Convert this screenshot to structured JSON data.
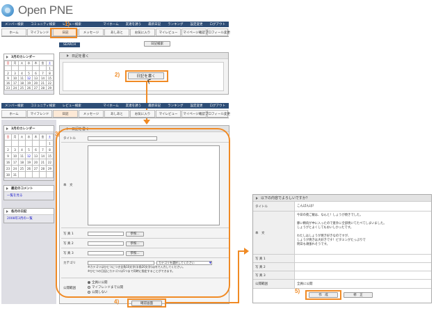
{
  "app": {
    "title": "Open PNE"
  },
  "searchbar": {
    "items": [
      "メンバー検索",
      "コミュニティ検索",
      "レビュー検索",
      "マイホーム",
      "友達を誘う",
      "最新日記",
      "ランキング",
      "設定変更",
      "ログアウト"
    ]
  },
  "nav": {
    "tabs": [
      "ホーム",
      "マイフレンド",
      "日記",
      "メッセージ",
      "あしあと",
      "お気に入り",
      "マイレビュー",
      "マイページ確認",
      "プロフィール変更"
    ]
  },
  "search": {
    "button": "SEARCH",
    "diary_search": "日記検索"
  },
  "calendar": {
    "title": "3月のカレンダー",
    "weekdays": [
      "日",
      "月",
      "火",
      "水",
      "木",
      "金",
      "土"
    ],
    "rows": [
      [
        "",
        "",
        "",
        "",
        "",
        "",
        "1"
      ],
      [
        "2",
        "3",
        "4",
        "5",
        "6",
        "7",
        "8"
      ],
      [
        "9",
        "10",
        "11",
        "12",
        "13",
        "14",
        "15"
      ],
      [
        "16",
        "17",
        "18",
        "19",
        "20",
        "21",
        "22"
      ],
      [
        "23",
        "24",
        "25",
        "26",
        "27",
        "28",
        "29"
      ],
      [
        "30",
        "31",
        "",
        "",
        "",
        "",
        ""
      ]
    ]
  },
  "top_panel": {
    "header": "日記を書く",
    "write_button": "日記を書く"
  },
  "form": {
    "header": "日記を書く",
    "title_label": "タイトル",
    "body_label": "本　文",
    "photo1": "写 真 1",
    "photo2": "写 真 2",
    "photo3": "写 真 3",
    "browse": "参照...",
    "category_label": "カテゴリ",
    "category_select": "カテゴリを選択してください",
    "category_note1": "※カテゴリはひとつにつき全角10文字(半角20文字)以内で入力してください。",
    "category_note2": "※ひとつの日記にカテゴリは5つまで同時に指定することができます。",
    "visibility_label": "公開範囲",
    "vis_options": [
      "全員に公開",
      "マイフレンドまで公開",
      "公開しない"
    ],
    "confirm_button": "確認画面"
  },
  "side": {
    "recent_comments": "最近のコメント",
    "recent_link": "一覧を見る",
    "monthly": "各月の日記",
    "monthly_link": "2008年3月の一覧"
  },
  "confirm": {
    "header": "以下の内容でよろしいですか？",
    "title_label": "タイトル",
    "title_value": "こんばんは！",
    "body_label": "本　文",
    "body_lines": [
      "今日の夜ご飯は、なんと！しょうが焼きでした。",
      "",
      "豚い精肉が中に入ったので意外に全部焼いてたべてしまいました。",
      "しょうがとよくしてもおいしかったです。",
      "",
      "わたしはしょうが焼き好きなのですが、",
      "しょうが焼きは大好きです！ビタミンがたっぷりで",
      "明日も頑張れそうです。"
    ],
    "photo1": "写 真 1",
    "photo2": "写 真 2",
    "photo3": "写 真 3",
    "vis_label": "公開範囲",
    "vis_value": "全員に公開",
    "create_button": "作　成",
    "edit_button": "修　正"
  },
  "steps": [
    "1)",
    "2)",
    "3)",
    "4)",
    "5)"
  ],
  "colors": {
    "accent": "#f08a24",
    "bar": "#2d4d76"
  }
}
